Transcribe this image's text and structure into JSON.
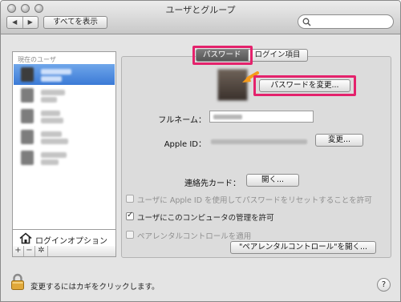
{
  "window": {
    "title": "ユーザとグループ",
    "back_glyph": "◀",
    "forward_glyph": "▶",
    "show_all_label": "すべてを表示",
    "search_placeholder": ""
  },
  "sidebar": {
    "section_label": "現在のユーザ",
    "users": [
      {
        "selected": true
      },
      {
        "selected": false
      },
      {
        "selected": false
      },
      {
        "selected": false
      },
      {
        "selected": false
      }
    ],
    "login_options_label": "ログインオプション",
    "buttons": [
      "+",
      "−",
      "✲"
    ]
  },
  "tabs": {
    "password": "パスワード",
    "login_items": "ログイン項目"
  },
  "main": {
    "change_password_label": "パスワードを変更...",
    "fullname_label": "フルネーム：",
    "appleid_label": "Apple ID：",
    "change_appleid_label": "変更...",
    "contact_card_label": "連絡先カード：",
    "open_card_label": "開く...",
    "checkbox_reset": "ユーザに Apple ID を使用してパスワードをリセットすることを許可",
    "checkbox_admin": "ユーザにこのコンピュータの管理を許可",
    "checkbox_parental": "ペアレンタルコントロールを適用",
    "open_parental_label": "\"ペアレンタルコントロール\"を開く..."
  },
  "footer": {
    "lock_text": "変更するにはカギをクリックします。",
    "help_glyph": "?"
  },
  "colors": {
    "highlight": "#e4226c",
    "arrow": "#f59a1a",
    "selection": "#3b7ad6"
  }
}
